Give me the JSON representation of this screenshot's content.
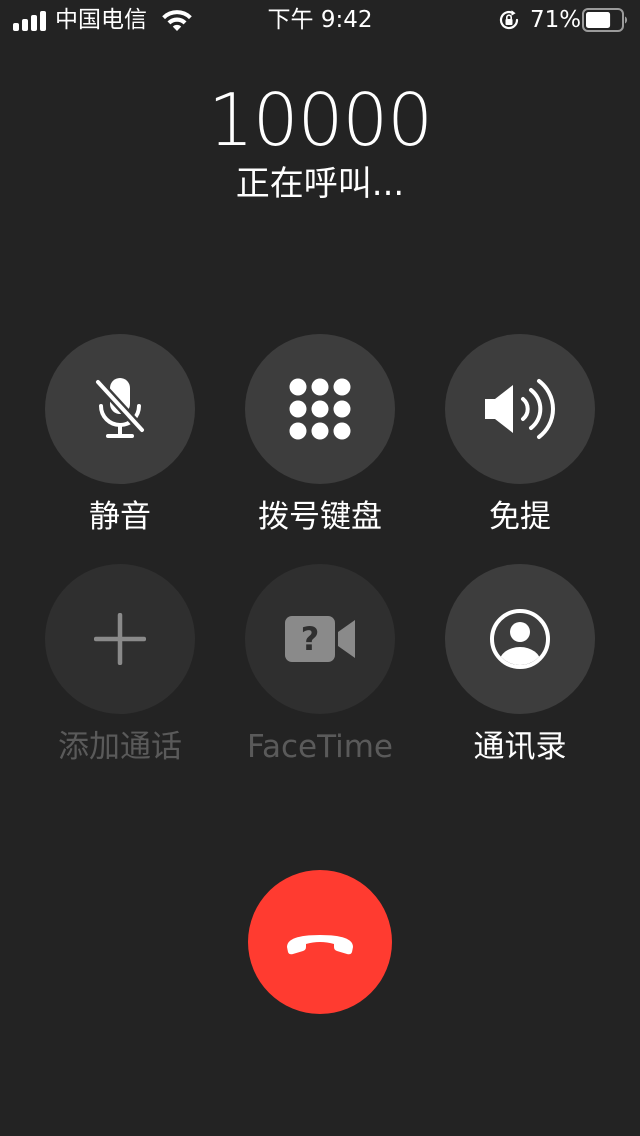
{
  "status_bar": {
    "carrier": "中国电信",
    "time": "下午 9:42",
    "battery_percent": "71%",
    "battery_level": 0.71,
    "icons": [
      "signal-icon",
      "wifi-icon",
      "rotation-lock-icon",
      "battery-icon"
    ]
  },
  "caller": {
    "number": "10000",
    "status": "正在呼叫..."
  },
  "controls": {
    "mute": {
      "label": "静音",
      "icon": "mute-microphone-icon"
    },
    "keypad": {
      "label": "拨号键盘",
      "icon": "keypad-icon"
    },
    "speaker": {
      "label": "免提",
      "icon": "speaker-icon"
    },
    "add_call": {
      "label": "添加通话",
      "icon": "plus-icon"
    },
    "facetime": {
      "label": "FaceTime",
      "icon": "facetime-video-icon"
    },
    "contacts": {
      "label": "通讯录",
      "icon": "contact-icon"
    }
  },
  "end_call": {
    "icon": "end-call-phone-icon"
  },
  "colors": {
    "background": "#232323",
    "button": "#3d3d3d",
    "button_disabled": "#2f2f2f",
    "disabled_text": "#5a5a5a",
    "end_call": "#ff3b30"
  }
}
